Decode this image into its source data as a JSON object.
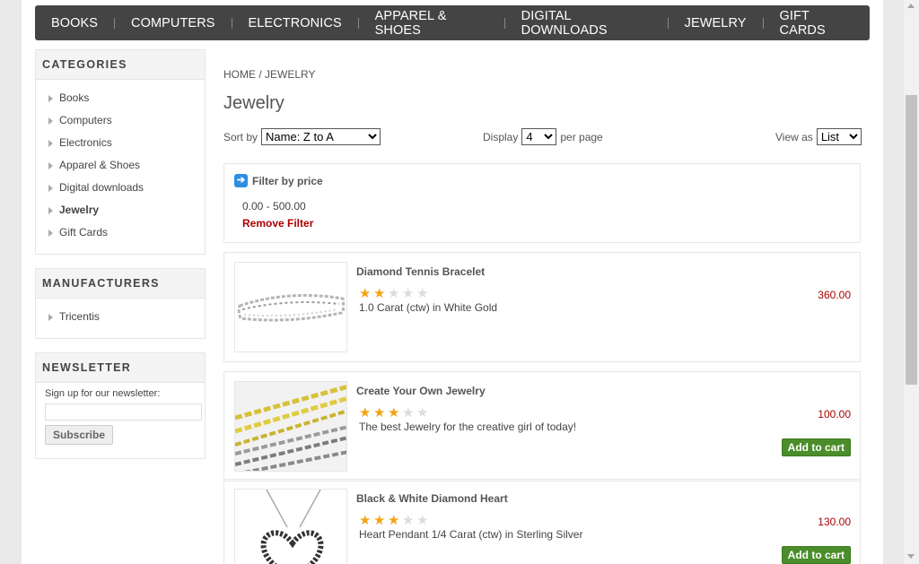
{
  "top_menu": [
    "BOOKS",
    "COMPUTERS",
    "ELECTRONICS",
    "APPAREL & SHOES",
    "DIGITAL DOWNLOADS",
    "JEWELRY",
    "GIFT CARDS"
  ],
  "categories": {
    "title": "CATEGORIES",
    "items": [
      {
        "label": "Books"
      },
      {
        "label": "Computers"
      },
      {
        "label": "Electronics"
      },
      {
        "label": "Apparel & Shoes"
      },
      {
        "label": "Digital downloads"
      },
      {
        "label": "Jewelry",
        "active": true
      },
      {
        "label": "Gift Cards"
      }
    ]
  },
  "manufacturers": {
    "title": "MANUFACTURERS",
    "items": [
      {
        "label": "Tricentis"
      }
    ]
  },
  "newsletter": {
    "title": "NEWSLETTER",
    "prompt": "Sign up for our newsletter:",
    "email_value": "",
    "button": "Subscribe"
  },
  "breadcrumb": {
    "home": "HOME",
    "separator": "/",
    "current": "JEWELRY"
  },
  "page_title": "Jewelry",
  "sort": {
    "label": "Sort by",
    "selected": "Name: Z to A"
  },
  "display": {
    "label": "Display",
    "selected": "4",
    "suffix": "per page"
  },
  "view": {
    "label": "View as",
    "selected": "List"
  },
  "filter": {
    "title": "Filter by price",
    "range": "0.00 - 500.00",
    "remove": "Remove Filter"
  },
  "products": [
    {
      "name": "Diamond Tennis Bracelet",
      "rating": 2,
      "max_rating": 5,
      "description": "1.0 Carat (ctw) in White Gold",
      "price": "360.00",
      "add_to_cart": "",
      "image": "bracelet-image"
    },
    {
      "name": "Create Your Own Jewelry",
      "rating": 3,
      "max_rating": 5,
      "description": "The best Jewelry for the creative girl of today!",
      "price": "100.00",
      "add_to_cart": "Add to cart",
      "image": "chains-image"
    },
    {
      "name": "Black & White Diamond Heart",
      "rating": 3,
      "max_rating": 5,
      "description": "Heart Pendant 1/4 Carat (ctw) in Sterling Silver",
      "price": "130.00",
      "add_to_cart": "Add to cart",
      "image": "heart-pendant-image"
    }
  ],
  "colors": {
    "menu_bg": "#444444",
    "price": "#aa0000",
    "cart_button": "#4a8d2a",
    "star": "#f2a414"
  }
}
